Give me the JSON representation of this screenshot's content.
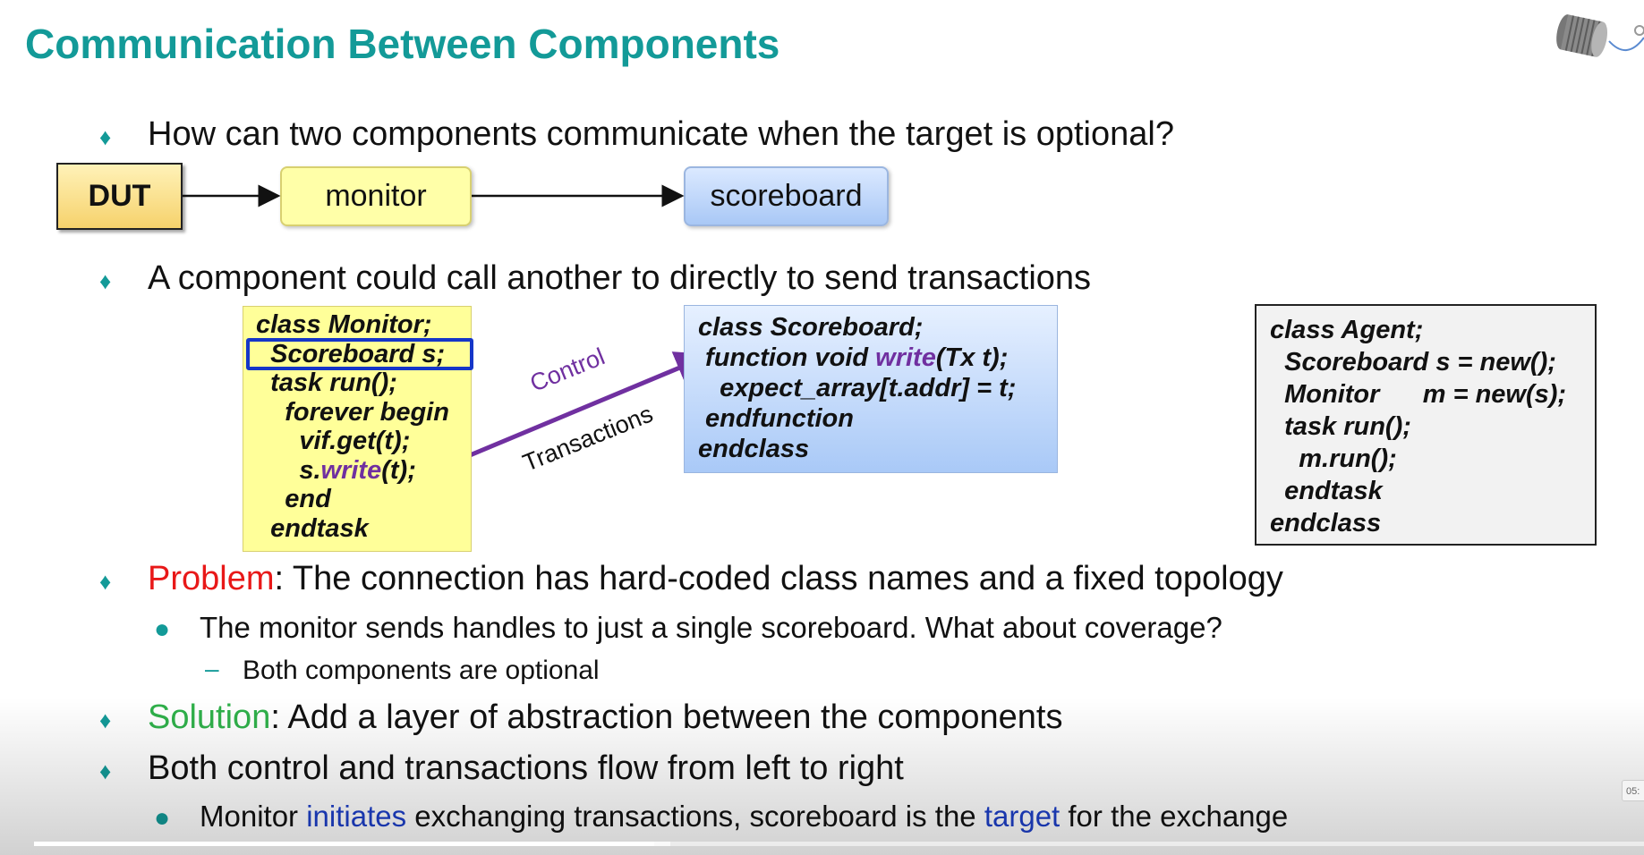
{
  "slide": {
    "title": "Communication Between Components",
    "bullet1": "How can two components communicate when the target is optional?",
    "diagram": {
      "dut": "DUT",
      "monitor": "monitor",
      "scoreboard": "scoreboard"
    },
    "bullet2": "A component could call another to directly to send transactions",
    "monitor_code": {
      "l1": "class Monitor;",
      "l2": "  Scoreboard s;",
      "l3": "  task run();",
      "l4": "    forever begin",
      "l5": "      vif.get(t);",
      "l6_pre": "      s.",
      "l6_hl": "write",
      "l6_post": "(t);",
      "l7": "    end",
      "l8": "  endtask"
    },
    "arrow_labels": {
      "control": "Control",
      "transactions": "Transactions"
    },
    "scoreboard_code": {
      "l1": "class Scoreboard;",
      "l2_pre": " function void ",
      "l2_hl": "write",
      "l2_post": "(Tx t);",
      "l3": "   expect_array[t.addr] = t;",
      "l4": " endfunction",
      "l5": "endclass"
    },
    "agent_code": {
      "l1": "class Agent;",
      "l2": "  Scoreboard s = new();",
      "l3": "  Monitor      m = new(s);",
      "l4": "  task run();",
      "l5": "    m.run();",
      "l6": "  endtask",
      "l7": "endclass"
    },
    "problem": {
      "keyword": "Problem",
      "rest": ": The connection has hard-coded class names and a fixed topology",
      "sub1": "The monitor sends handles to just a single scoreboard. What about coverage?",
      "sub2": "Both components are optional"
    },
    "solution": {
      "keyword": "Solution",
      "rest": ": Add a layer of abstraction between the components"
    },
    "bullet5": "Both control and transactions flow from left to right",
    "sub5": {
      "p1": "Monitor ",
      "hl1": "initiates",
      "p2": " exchanging transactions, scoreboard is the ",
      "hl2": "target",
      "p3": " for the exchange"
    }
  },
  "player": {
    "time_label": "05:",
    "progress_fraction": 0.385
  },
  "colors": {
    "title": "#139a98",
    "problem": "#e81818",
    "solution": "#2fb04a",
    "highlight_purple": "#7030a0",
    "highlight_blue": "#1d3fc8"
  },
  "icons": [
    "diamond-bullet-icon",
    "dot-bullet-icon",
    "dash-bullet-icon",
    "arrow-icon",
    "tin-can-phone-logo-icon"
  ]
}
